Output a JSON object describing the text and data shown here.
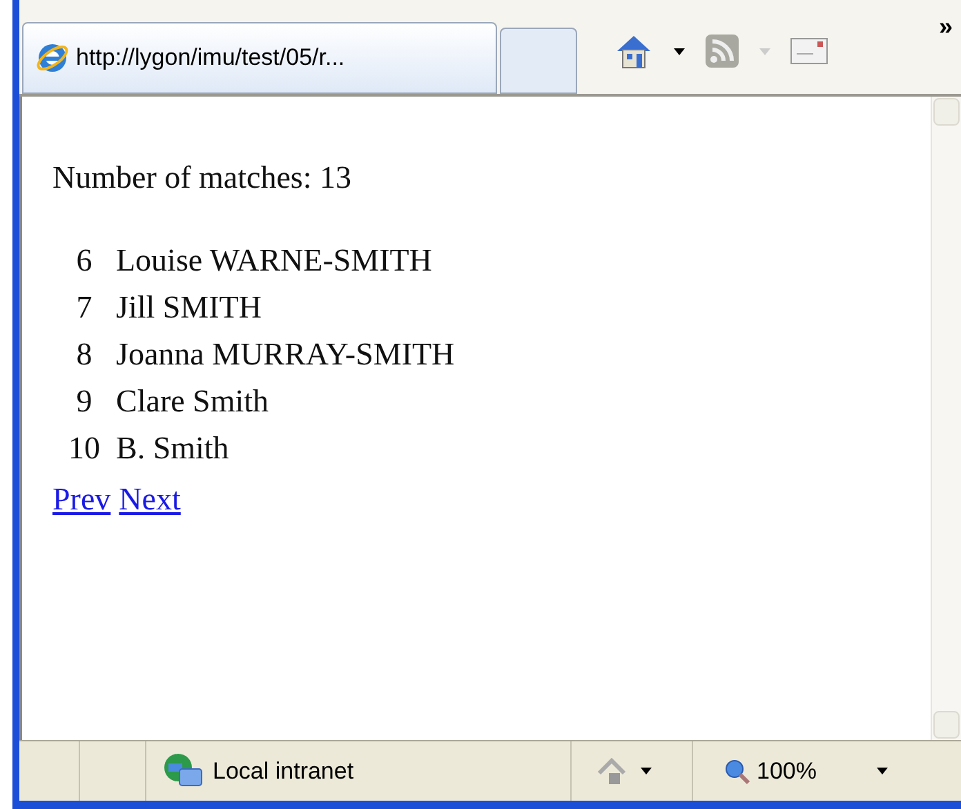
{
  "tab": {
    "title": "http://lygon/imu/test/05/r..."
  },
  "toolbar": {
    "overflow": "»"
  },
  "page": {
    "summary": "Number of matches: 13",
    "results": [
      {
        "number": "6",
        "name": "Louise WARNE-SMITH"
      },
      {
        "number": "7",
        "name": "Jill SMITH"
      },
      {
        "number": "8",
        "name": "Joanna MURRAY-SMITH"
      },
      {
        "number": "9",
        "name": "Clare Smith"
      },
      {
        "number": "10",
        "name": "B. Smith"
      }
    ],
    "links": [
      "Prev",
      "Next"
    ]
  },
  "status_bar": {
    "zone": "Local intranet",
    "zoom": "100%"
  }
}
